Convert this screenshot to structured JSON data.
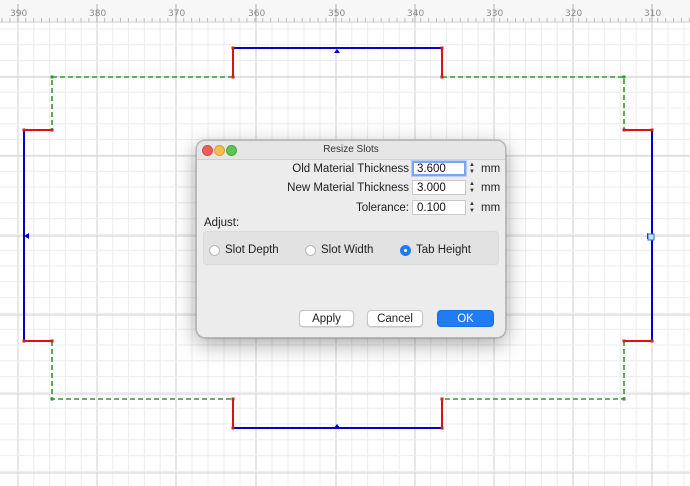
{
  "ruler": {
    "ticks": [
      "390",
      "380",
      "370",
      "360",
      "350",
      "340",
      "330",
      "320",
      "310"
    ]
  },
  "colors": {
    "slot": "#0000cc",
    "tab": "#dd1111",
    "edge": "#2e9b2e",
    "grid": "#d9d9d9"
  },
  "dialog": {
    "title": "Resize Slots",
    "fields": [
      {
        "label": "Old Material Thickness",
        "value": "3.600",
        "unit": "mm"
      },
      {
        "label": "New Material Thickness",
        "value": "3.000",
        "unit": "mm"
      },
      {
        "label": "Tolerance:",
        "value": "0.100",
        "unit": "mm"
      }
    ],
    "adjust_label": "Adjust:",
    "options": [
      "Slot Depth",
      "Slot Width",
      "Tab Height"
    ],
    "selected_option": "Tab Height",
    "buttons": {
      "apply": "Apply",
      "cancel": "Cancel",
      "ok": "OK"
    }
  }
}
